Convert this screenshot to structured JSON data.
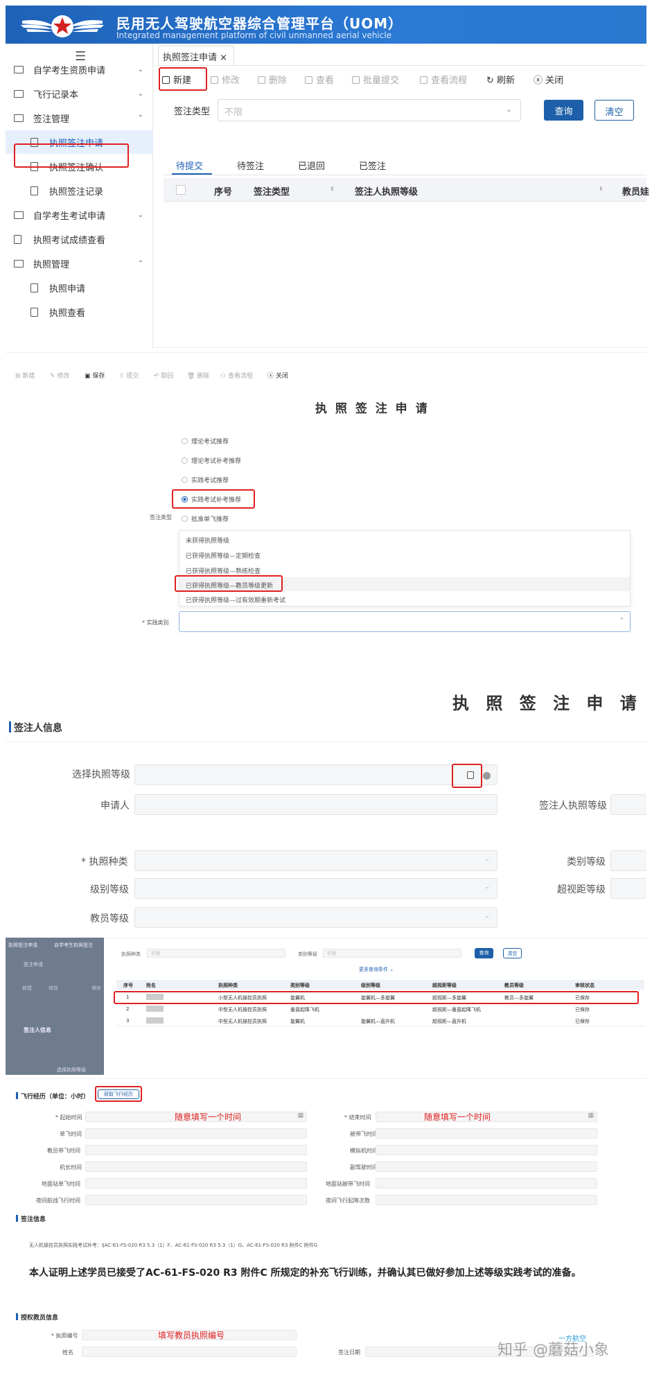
{
  "header": {
    "title": "民用无人驾驶航空器综合管理平台（UOM）",
    "subtitle": "Integrated management platform of civil unmanned aerial vehicle"
  },
  "sidebar": {
    "items": [
      {
        "label": "自学考生资质申请"
      },
      {
        "label": "飞行记录本"
      },
      {
        "label": "签注管理"
      },
      {
        "label": "执照签注申请"
      },
      {
        "label": "执照签注确认"
      },
      {
        "label": "执照签注记录"
      },
      {
        "label": "自学考生考试申请"
      },
      {
        "label": "执照考试成绩查看"
      },
      {
        "label": "执照管理"
      },
      {
        "label": "执照申请"
      },
      {
        "label": "执照查看"
      }
    ]
  },
  "tab": {
    "label": "执照签注申请",
    "close": "×"
  },
  "toolbar": {
    "new": "新建",
    "edit": "修改",
    "delete": "删除",
    "view": "查看",
    "batch": "批量提交",
    "flow": "查看流程",
    "refresh": "刷新",
    "close": "关闭"
  },
  "filter": {
    "label": "签注类型",
    "placeholder": "不限",
    "query": "查询",
    "clear": "清空"
  },
  "subtabs": [
    "待提交",
    "待签注",
    "已退回",
    "已签注"
  ],
  "grid": {
    "cols": [
      "序号",
      "签注类型",
      "签注人执照等级",
      "教员娃"
    ]
  },
  "form2": {
    "toolbar": [
      "新建",
      "修改",
      "保存",
      "提交",
      "取回",
      "删除",
      "查看流程",
      "关闭"
    ],
    "title": "执 照 签 注 申 请",
    "radios": [
      "理论考试推荐",
      "理论考试补考推荐",
      "实践考试推荐",
      "实践考试补考推荐",
      "批准单飞推荐"
    ],
    "type_label": "签注类型",
    "options": [
      "未获得执照等级",
      "已获得执照等级—定期检查",
      "已获得执照等级—熟练检查",
      "已获得执照等级—教员等级更新",
      "已获得执照等级—过有效期重新考试"
    ],
    "practice_label": "* 实践类别"
  },
  "form3": {
    "title": "执 照 签 注 申 请",
    "section": "签注人信息",
    "labels": {
      "select": "选择执照等级",
      "applicant": "申请人",
      "signer_level": "签注人执照等级",
      "license_type": "* 执照种类",
      "category": "类别等级",
      "class": "级别等级",
      "bvlos": "超视距等级",
      "instructor": "教员等级"
    }
  },
  "popup": {
    "filter1": "执照种类",
    "filter1_val": "不限",
    "filter2": "类别等级",
    "filter2_val": "不限",
    "query": "查询",
    "clear": "清空",
    "more": "更多查询条件 ⌄",
    "cols": [
      "序号",
      "姓名",
      "执照种类",
      "类别等级",
      "级别等级",
      "超视距等级",
      "教员等级",
      "审核状态"
    ],
    "rows": [
      [
        "1",
        "",
        "小型无人机操控员执照",
        "旋翼机",
        "旋翼机—多旋翼",
        "超视距—多旋翼",
        "教员—多旋翼",
        "已保存"
      ],
      [
        "2",
        "",
        "中型无人机操控员执照",
        "垂直起降飞机",
        "",
        "超视距—垂直起降飞机",
        "",
        "已保存"
      ],
      [
        "3",
        "",
        "中型无人机操控员执照",
        "旋翼机",
        "旋翼机—直升机",
        "超视距—直升机",
        "",
        "已保存"
      ]
    ],
    "left": {
      "tab1": "执照签注申请",
      "tab2": "自学考生执照签注",
      "step": "签注申请",
      "b1": "新建",
      "b2": "修改",
      "b3": "保存",
      "sec": "签注人信息",
      "lab": "选择执照等级"
    }
  },
  "form4": {
    "flight_label": "飞行经历（单位：小时）",
    "fetch": "获取飞行经历",
    "start": "* 起始时间",
    "end": "* 结束时间",
    "hint": "随意填写一个时间",
    "left_labels": [
      "单飞时间",
      "教员带飞时间",
      "机长时间",
      "地面站单飞时间",
      "夜间航线飞行时间"
    ],
    "right_labels": [
      "被带飞时间",
      "模拟机时间",
      "副驾驶时间",
      "地面站被带飞时间",
      "夜间飞行起降次数"
    ],
    "sign_sec": "签注信息",
    "rule": "无人机操控员执照实践考试补考：§AC-61-FS-020 R3 5.3（1）F、AC-61-FS-020 R3 5.3（1）G、AC-61-FS-020 R3 附件C 附件G",
    "statement": "本人证明上述学员已接受了AC-61-FS-020 R3 附件C 所规定的补充飞行训练，并确认其已做好参加上述等级实践考试的准备。",
    "auth_sec": "授权教员信息",
    "license_no": "* 执照编号",
    "license_hint": "填写教员执照编号",
    "name": "姓名",
    "date": "签注日期"
  },
  "watermark": {
    "brand": "一方航空",
    "text": "知乎 @蘑菇小象"
  }
}
